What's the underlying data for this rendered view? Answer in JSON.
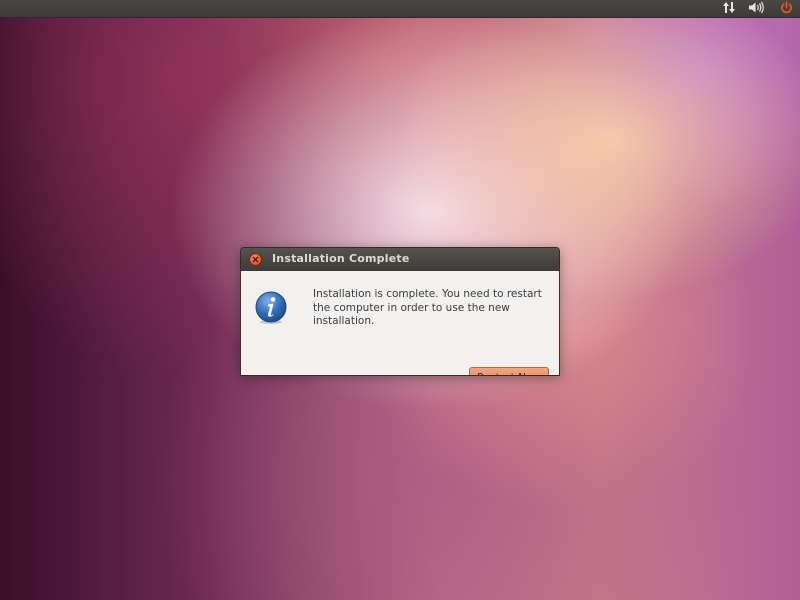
{
  "panel": {
    "indicators": [
      {
        "icon": "network-arrows-icon"
      },
      {
        "icon": "volume-icon"
      },
      {
        "icon": "power-icon",
        "color": "#e85b2a"
      }
    ]
  },
  "dialog": {
    "title": "Installation Complete",
    "close_icon": "close-icon",
    "info_icon": "info-icon",
    "message": "Installation is complete. You need to restart the computer in order to use the new installation.",
    "restart_label": "Restart Now",
    "accent_color": "#e9804f"
  }
}
